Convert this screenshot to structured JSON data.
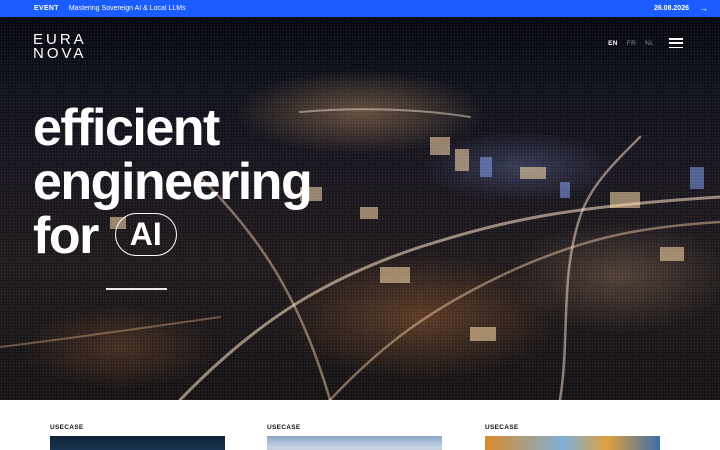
{
  "event_bar": {
    "tag": "EVENT",
    "title": "Mastering Sovereign AI & Local LLMs",
    "date": "26.08.2026",
    "arrow_icon": "arrow-right-icon",
    "background": "#1a5cff"
  },
  "header": {
    "logo_top": "EURA",
    "logo_bottom": "NOVA",
    "languages": [
      "EN",
      "FR",
      "NL"
    ],
    "active_language": "EN",
    "menu_icon": "hamburger-menu-icon"
  },
  "hero": {
    "line1": "efficient",
    "line2": "engineering",
    "line3": "for",
    "pill": "AI"
  },
  "usecases": [
    {
      "label": "USECASE"
    },
    {
      "label": "USECASE"
    },
    {
      "label": "USECASE"
    }
  ]
}
